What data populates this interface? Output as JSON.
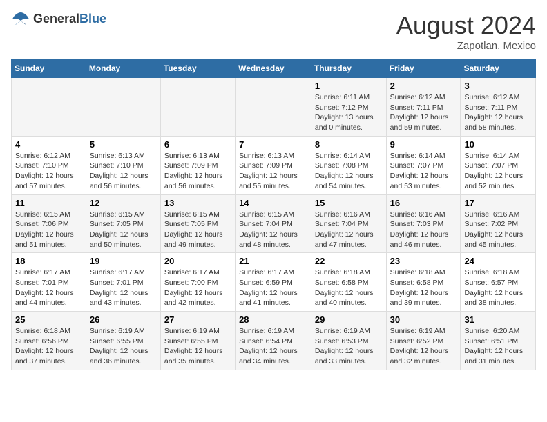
{
  "header": {
    "logo_general": "General",
    "logo_blue": "Blue",
    "month_year": "August 2024",
    "location": "Zapotlan, Mexico"
  },
  "days_of_week": [
    "Sunday",
    "Monday",
    "Tuesday",
    "Wednesday",
    "Thursday",
    "Friday",
    "Saturday"
  ],
  "weeks": [
    [
      {
        "day": "",
        "info": ""
      },
      {
        "day": "",
        "info": ""
      },
      {
        "day": "",
        "info": ""
      },
      {
        "day": "",
        "info": ""
      },
      {
        "day": "1",
        "info": "Sunrise: 6:11 AM\nSunset: 7:12 PM\nDaylight: 13 hours\nand 0 minutes."
      },
      {
        "day": "2",
        "info": "Sunrise: 6:12 AM\nSunset: 7:11 PM\nDaylight: 12 hours\nand 59 minutes."
      },
      {
        "day": "3",
        "info": "Sunrise: 6:12 AM\nSunset: 7:11 PM\nDaylight: 12 hours\nand 58 minutes."
      }
    ],
    [
      {
        "day": "4",
        "info": "Sunrise: 6:12 AM\nSunset: 7:10 PM\nDaylight: 12 hours\nand 57 minutes."
      },
      {
        "day": "5",
        "info": "Sunrise: 6:13 AM\nSunset: 7:10 PM\nDaylight: 12 hours\nand 56 minutes."
      },
      {
        "day": "6",
        "info": "Sunrise: 6:13 AM\nSunset: 7:09 PM\nDaylight: 12 hours\nand 56 minutes."
      },
      {
        "day": "7",
        "info": "Sunrise: 6:13 AM\nSunset: 7:09 PM\nDaylight: 12 hours\nand 55 minutes."
      },
      {
        "day": "8",
        "info": "Sunrise: 6:14 AM\nSunset: 7:08 PM\nDaylight: 12 hours\nand 54 minutes."
      },
      {
        "day": "9",
        "info": "Sunrise: 6:14 AM\nSunset: 7:07 PM\nDaylight: 12 hours\nand 53 minutes."
      },
      {
        "day": "10",
        "info": "Sunrise: 6:14 AM\nSunset: 7:07 PM\nDaylight: 12 hours\nand 52 minutes."
      }
    ],
    [
      {
        "day": "11",
        "info": "Sunrise: 6:15 AM\nSunset: 7:06 PM\nDaylight: 12 hours\nand 51 minutes."
      },
      {
        "day": "12",
        "info": "Sunrise: 6:15 AM\nSunset: 7:05 PM\nDaylight: 12 hours\nand 50 minutes."
      },
      {
        "day": "13",
        "info": "Sunrise: 6:15 AM\nSunset: 7:05 PM\nDaylight: 12 hours\nand 49 minutes."
      },
      {
        "day": "14",
        "info": "Sunrise: 6:15 AM\nSunset: 7:04 PM\nDaylight: 12 hours\nand 48 minutes."
      },
      {
        "day": "15",
        "info": "Sunrise: 6:16 AM\nSunset: 7:04 PM\nDaylight: 12 hours\nand 47 minutes."
      },
      {
        "day": "16",
        "info": "Sunrise: 6:16 AM\nSunset: 7:03 PM\nDaylight: 12 hours\nand 46 minutes."
      },
      {
        "day": "17",
        "info": "Sunrise: 6:16 AM\nSunset: 7:02 PM\nDaylight: 12 hours\nand 45 minutes."
      }
    ],
    [
      {
        "day": "18",
        "info": "Sunrise: 6:17 AM\nSunset: 7:01 PM\nDaylight: 12 hours\nand 44 minutes."
      },
      {
        "day": "19",
        "info": "Sunrise: 6:17 AM\nSunset: 7:01 PM\nDaylight: 12 hours\nand 43 minutes."
      },
      {
        "day": "20",
        "info": "Sunrise: 6:17 AM\nSunset: 7:00 PM\nDaylight: 12 hours\nand 42 minutes."
      },
      {
        "day": "21",
        "info": "Sunrise: 6:17 AM\nSunset: 6:59 PM\nDaylight: 12 hours\nand 41 minutes."
      },
      {
        "day": "22",
        "info": "Sunrise: 6:18 AM\nSunset: 6:58 PM\nDaylight: 12 hours\nand 40 minutes."
      },
      {
        "day": "23",
        "info": "Sunrise: 6:18 AM\nSunset: 6:58 PM\nDaylight: 12 hours\nand 39 minutes."
      },
      {
        "day": "24",
        "info": "Sunrise: 6:18 AM\nSunset: 6:57 PM\nDaylight: 12 hours\nand 38 minutes."
      }
    ],
    [
      {
        "day": "25",
        "info": "Sunrise: 6:18 AM\nSunset: 6:56 PM\nDaylight: 12 hours\nand 37 minutes."
      },
      {
        "day": "26",
        "info": "Sunrise: 6:19 AM\nSunset: 6:55 PM\nDaylight: 12 hours\nand 36 minutes."
      },
      {
        "day": "27",
        "info": "Sunrise: 6:19 AM\nSunset: 6:55 PM\nDaylight: 12 hours\nand 35 minutes."
      },
      {
        "day": "28",
        "info": "Sunrise: 6:19 AM\nSunset: 6:54 PM\nDaylight: 12 hours\nand 34 minutes."
      },
      {
        "day": "29",
        "info": "Sunrise: 6:19 AM\nSunset: 6:53 PM\nDaylight: 12 hours\nand 33 minutes."
      },
      {
        "day": "30",
        "info": "Sunrise: 6:19 AM\nSunset: 6:52 PM\nDaylight: 12 hours\nand 32 minutes."
      },
      {
        "day": "31",
        "info": "Sunrise: 6:20 AM\nSunset: 6:51 PM\nDaylight: 12 hours\nand 31 minutes."
      }
    ]
  ]
}
